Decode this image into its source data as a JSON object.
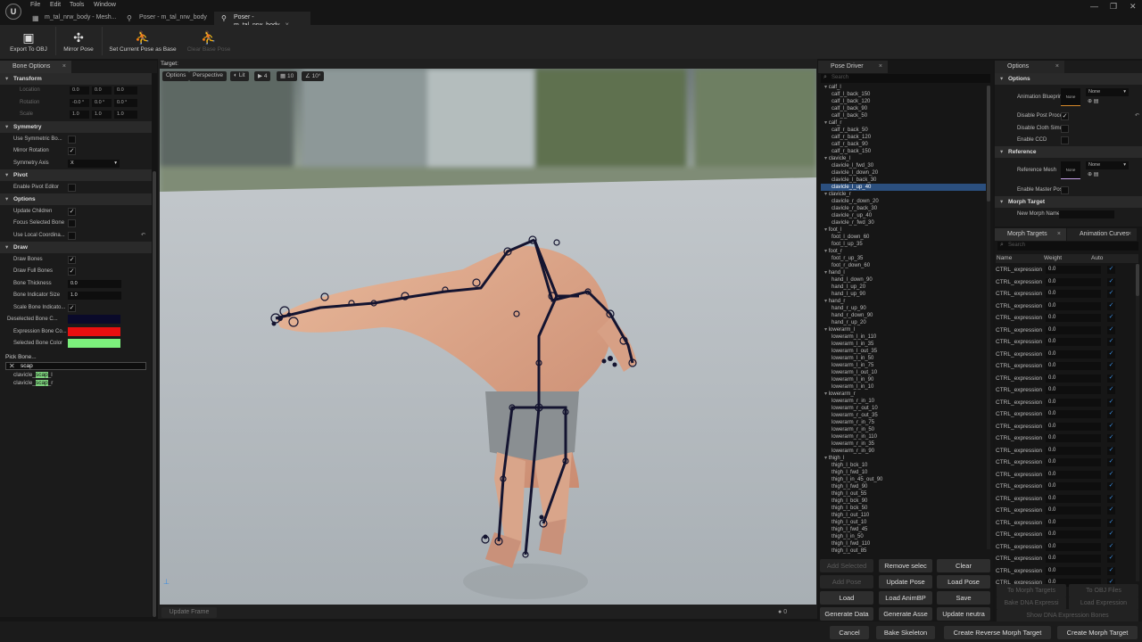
{
  "app": {
    "logo": "U",
    "menus": [
      "File",
      "Edit",
      "Tools",
      "Window"
    ],
    "tabs": [
      {
        "label": "m_tal_nrw_body - Mesh..."
      },
      {
        "label": "Poser - m_tal_nrw_body"
      },
      {
        "label": "Poser - m_tal_nrw_body"
      }
    ],
    "close_glyph": "×",
    "win": [
      "—",
      "❐",
      "✕"
    ]
  },
  "toolbar": {
    "export": "Export To OBJ",
    "mirror": "Mirror Pose",
    "set_base": "Set Current Pose as Base",
    "clear_base": "Clear Base Pose"
  },
  "bone_options": {
    "title": "Bone Options",
    "transform": {
      "header": "Transform",
      "location": "Location",
      "rotation": "Rotation",
      "scale": "Scale",
      "loc": [
        "0.0",
        "0.0",
        "0.0"
      ],
      "rot": [
        "-0.0 °",
        "0.0 °",
        "0.0 °"
      ],
      "scl": [
        "1.0",
        "1.0",
        "1.0"
      ]
    },
    "symmetry": {
      "header": "Symmetry",
      "use": "Use Symmetric Bo...",
      "mirror": "Mirror Rotation",
      "axis": "Symmetry Axis",
      "axis_val": "X"
    },
    "pivot": {
      "header": "Pivot",
      "enable": "Enable Pivot Editor"
    },
    "options": {
      "header": "Options",
      "update": "Update Children",
      "focus": "Focus Selected Bone",
      "local": "Use Local Coordina..."
    },
    "draw": {
      "header": "Draw",
      "bones": "Draw Bones",
      "full": "Draw Full Bones",
      "thickness": "Bone Thickness",
      "thickness_val": "0.0",
      "indicator": "Bone Indicator Size",
      "indicator_val": "1.0",
      "scale_ind": "Scale Bone Indicato...",
      "desel": "Deselected Bone C...",
      "expr": "Expression Bone Co...",
      "sel": "Selected Bone Color"
    },
    "pick": {
      "label": "Pick Bone...",
      "query": "scap",
      "results": [
        {
          "pre": "clavicle_",
          "hl": "scap",
          "post": "_l"
        },
        {
          "pre": "clavicle_",
          "hl": "scap",
          "post": "_r"
        }
      ]
    }
  },
  "colors": {
    "deselected": "#0a0a2a",
    "expression": "#e81010",
    "selected": "#7cf07c",
    "accent": "#2b4f7e"
  },
  "viewport": {
    "target": "Target:",
    "options": "Options",
    "perspective": "Perspective",
    "lit": "Lit",
    "cams": "4",
    "grid": "10",
    "angle": "10°",
    "update_frame": "Update Frame",
    "frame": "0"
  },
  "pose_driver": {
    "title": "Pose Driver",
    "search": "Search",
    "groups": [
      {
        "name": "calf_l",
        "items": [
          "calf_l_back_150",
          "calf_l_back_120",
          "calf_l_back_90",
          "calf_l_back_50"
        ]
      },
      {
        "name": "calf_r",
        "items": [
          "calf_r_back_50",
          "calf_r_back_120",
          "calf_r_back_90",
          "calf_r_back_150"
        ]
      },
      {
        "name": "clavicle_l",
        "items": [
          "clavicle_l_fwd_30",
          "clavicle_l_down_20",
          "clavicle_l_back_30",
          "clavicle_l_up_40"
        ]
      },
      {
        "name": "clavicle_r",
        "items": [
          "clavicle_r_down_20",
          "clavicle_r_back_30",
          "clavicle_r_up_40",
          "clavicle_r_fwd_30"
        ]
      },
      {
        "name": "foot_l",
        "items": [
          "foot_l_down_60",
          "foot_l_up_35"
        ]
      },
      {
        "name": "foot_r",
        "items": [
          "foot_r_up_35",
          "foot_r_down_60"
        ]
      },
      {
        "name": "hand_l",
        "items": [
          "hand_l_down_90",
          "hand_l_up_20",
          "hand_l_up_90"
        ]
      },
      {
        "name": "hand_r",
        "items": [
          "hand_r_up_90",
          "hand_r_down_90",
          "hand_r_up_20"
        ]
      },
      {
        "name": "lowerarm_l",
        "items": [
          "lowerarm_l_in_110",
          "lowerarm_l_in_35",
          "lowerarm_l_out_35",
          "lowerarm_l_in_50",
          "lowerarm_l_in_75",
          "lowerarm_l_out_10",
          "lowerarm_l_in_90",
          "lowerarm_l_in_10"
        ]
      },
      {
        "name": "lowerarm_r",
        "items": [
          "lowerarm_r_in_10",
          "lowerarm_r_out_10",
          "lowerarm_r_out_35",
          "lowerarm_r_in_75",
          "lowerarm_r_in_50",
          "lowerarm_r_in_110",
          "lowerarm_r_in_35",
          "lowerarm_r_in_90"
        ]
      },
      {
        "name": "thigh_l",
        "items": [
          "thigh_l_bck_10",
          "thigh_l_fwd_10",
          "thigh_l_in_45_out_90",
          "thigh_l_fwd_90",
          "thigh_l_out_55",
          "thigh_l_bck_90",
          "thigh_l_bck_50",
          "thigh_l_out_110",
          "thigh_l_out_10",
          "thigh_l_fwd_45",
          "thigh_l_in_50",
          "thigh_l_fwd_110",
          "thigh_l_out_85"
        ]
      }
    ],
    "selected": "clavicle_l_up_40",
    "buttons": {
      "add_sel": "Add Selected",
      "remove": "Remove selec",
      "clear": "Clear",
      "add_pose": "Add Pose",
      "update_pose": "Update Pose",
      "load_pose": "Load Pose",
      "load": "Load",
      "load_anim": "Load AnimBP",
      "save": "Save",
      "gen_data": "Generate Data",
      "gen_asset": "Generate Asse",
      "update_neutral": "Update neutra"
    }
  },
  "options_panel": {
    "title": "Options",
    "options_hdr": "Options",
    "anim_bp": "Animation Blueprint",
    "none": "None",
    "disable_pp": "Disable Post Proce...",
    "disable_cloth": "Disable Cloth Simul...",
    "enable_ccd": "Enable CCD",
    "reference_hdr": "Reference",
    "ref_mesh": "Reference Mesh",
    "master_pose": "Enable Master Pose",
    "morph_hdr": "Morph Target",
    "new_morph": "New Morph Name"
  },
  "morph": {
    "tab1": "Morph Targets",
    "tab2": "Animation Curves",
    "search": "Search",
    "cols": [
      "Name",
      "Weight",
      "Auto"
    ],
    "row_name": "CTRL_expression",
    "row_val": "0.0",
    "count": 27,
    "to_morph": "To Morph Targets",
    "to_obj": "To OBJ Files",
    "bake_dna": "Bake DNA Expressi",
    "load_expr": "Load Expression",
    "show_dna": "Show DNA Expression Bones"
  },
  "footer": {
    "cancel": "Cancel",
    "bake": "Bake Skeleton",
    "reverse": "Create Reverse Morph Target",
    "create": "Create Morph Target"
  }
}
